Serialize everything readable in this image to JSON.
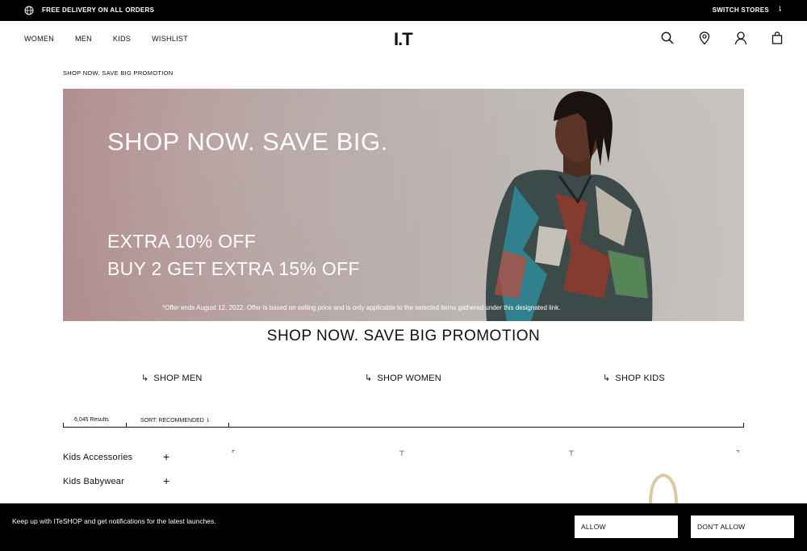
{
  "topbar": {
    "delivery": "FREE DELIVERY ON ALL ORDERS",
    "switch_stores": "SWITCH STORES",
    "switch_arrow": "⇂"
  },
  "header": {
    "nav": [
      "WOMEN",
      "MEN",
      "KIDS",
      "WISHLIST"
    ],
    "logo": "I.T"
  },
  "breadcrumb": "SHOP NOW. SAVE BIG PROMOTION",
  "banner": {
    "headline": "SHOP NOW. SAVE BIG.",
    "line1": "EXTRA 10% OFF",
    "line2": "BUY 2 GET EXTRA 15% OFF",
    "fine_print": "*Offer ends August 12, 2022. Offer is based on selling price and is only applicable to the selected items gathered under this designated link."
  },
  "promo_title": "SHOP NOW. SAVE BIG PROMOTION",
  "shop_links": {
    "arrow": "↳",
    "men": "SHOP MEN",
    "women": "SHOP WOMEN",
    "kids": "SHOP KIDS"
  },
  "results": {
    "count": "6,045 Results",
    "sort": "SORT: RECOMMENDED ⇂"
  },
  "filters": [
    {
      "label": "Kids Accessories",
      "toggle": "+"
    },
    {
      "label": "Kids Babywear",
      "toggle": "+"
    }
  ],
  "notification": {
    "message": "Keep up with ITeSHOP and get notifications for the latest launches.",
    "allow": "ALLOW",
    "dont_allow": "DON'T ALLOW"
  }
}
